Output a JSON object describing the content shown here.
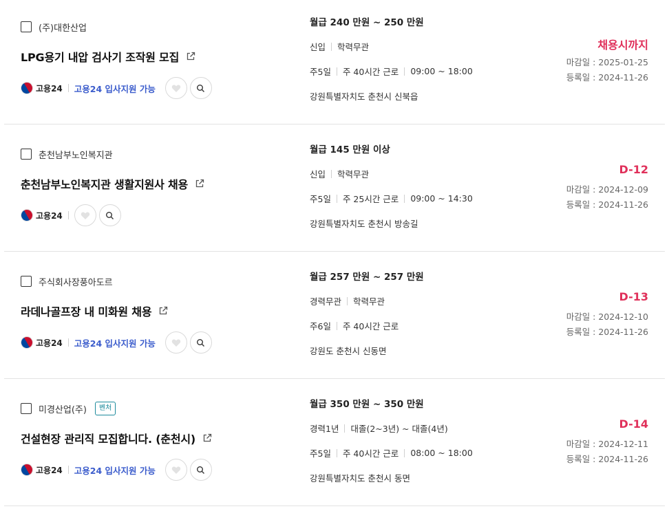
{
  "jobs": [
    {
      "company": "(주)대한산업",
      "tag": "",
      "title": "LPG용기 내압 검사기 조작원 모집",
      "source": "고용24",
      "apply": "고용24 입사지원 가능",
      "salary": "월급 240 만원 ~ 250 만원",
      "career": "신입",
      "education": "학력무관",
      "days": "주5일",
      "hours": "주 40시간 근로",
      "time": "09:00 ~ 18:00",
      "location": "강원특별자치도 춘천시 신북읍",
      "deadline": "채용시까지",
      "close_date": "마감일 : 2025-01-25",
      "reg_date": "등록일 : 2024-11-26"
    },
    {
      "company": "춘천남부노인복지관",
      "tag": "",
      "title": "춘천남부노인복지관 생활지원사 채용",
      "source": "고용24",
      "apply": "",
      "salary": "월급 145 만원 이상",
      "career": "신입",
      "education": "학력무관",
      "days": "주5일",
      "hours": "주 25시간 근로",
      "time": "09:00 ~ 14:30",
      "location": "강원특별자치도 춘천시 방송길",
      "deadline": "D-12",
      "close_date": "마감일 : 2024-12-09",
      "reg_date": "등록일 : 2024-11-26"
    },
    {
      "company": "주식회사장풍아도르",
      "tag": "",
      "title": "라데나골프장 내 미화원 채용",
      "source": "고용24",
      "apply": "고용24 입사지원 가능",
      "salary": "월급 257 만원 ~ 257 만원",
      "career": "경력무관",
      "education": "학력무관",
      "days": "주6일",
      "hours": "주 40시간 근로",
      "time": "",
      "location": "강원도 춘천시 신동면",
      "deadline": "D-13",
      "close_date": "마감일 : 2024-12-10",
      "reg_date": "등록일 : 2024-11-26"
    },
    {
      "company": "미경산업(주)",
      "tag": "벤처",
      "title": "건설현장 관리직 모집합니다. (춘천시)",
      "source": "고용24",
      "apply": "고용24 입사지원 가능",
      "salary": "월급 350 만원 ~ 350 만원",
      "career": "경력1년",
      "education": "대졸(2~3년) ~ 대졸(4년)",
      "days": "주5일",
      "hours": "주 40시간 근로",
      "time": "08:00 ~ 18:00",
      "location": "강원특별자치도 춘천시 동면",
      "deadline": "D-14",
      "close_date": "마감일 : 2024-12-11",
      "reg_date": "등록일 : 2024-11-26"
    }
  ],
  "icons": {
    "external": "external-link-icon",
    "heart": "heart-icon",
    "search": "search-icon",
    "logo": "goyong24-logo-icon"
  },
  "colors": {
    "deadline": "#e0305a",
    "apply_link": "#3b5ccc",
    "tag": "#1b8a9c"
  }
}
